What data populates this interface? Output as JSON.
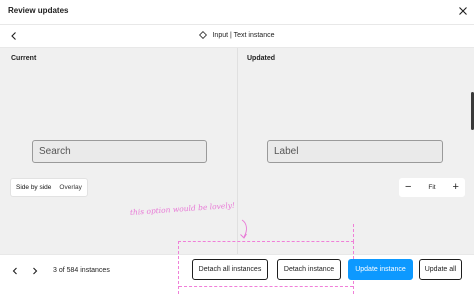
{
  "header": {
    "title": "Review updates"
  },
  "subheader": {
    "component_name": "Input | Text instance"
  },
  "panels": {
    "current": {
      "label": "Current",
      "field_text": "Search"
    },
    "updated": {
      "label": "Updated",
      "field_text": "Label"
    }
  },
  "view_toggle": {
    "options": [
      "Side by side",
      "Overlay"
    ],
    "selected": "Side by side"
  },
  "zoom": {
    "minus": "−",
    "fit": "Fit",
    "plus": "+"
  },
  "footer": {
    "count": "3 of 584 instances",
    "detach_all": "Detach all instances",
    "detach": "Detach instance",
    "update": "Update instance",
    "update_all": "Update all"
  },
  "annotation": {
    "text": "this option would be lovely!"
  },
  "colors": {
    "primary": "#0d99ff",
    "annotation": "#f07fd8",
    "canvas": "#f0f0f0"
  },
  "icons": [
    "close-icon",
    "chevron-left-icon",
    "component-diamond-icon",
    "chevron-right-icon"
  ]
}
